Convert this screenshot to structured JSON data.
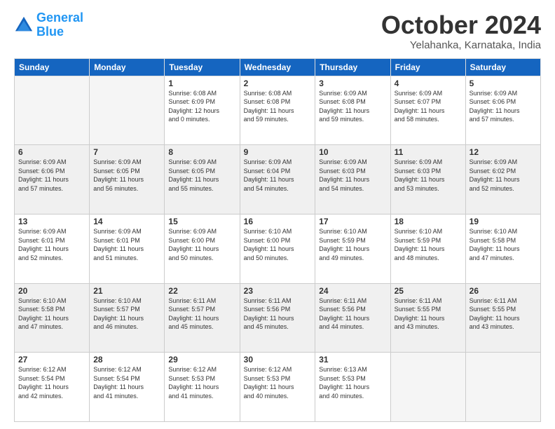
{
  "logo": {
    "text1": "General",
    "text2": "Blue"
  },
  "title": "October 2024",
  "subtitle": "Yelahanka, Karnataka, India",
  "weekdays": [
    "Sunday",
    "Monday",
    "Tuesday",
    "Wednesday",
    "Thursday",
    "Friday",
    "Saturday"
  ],
  "weeks": [
    [
      {
        "num": "",
        "info": ""
      },
      {
        "num": "",
        "info": ""
      },
      {
        "num": "1",
        "info": "Sunrise: 6:08 AM\nSunset: 6:09 PM\nDaylight: 12 hours\nand 0 minutes."
      },
      {
        "num": "2",
        "info": "Sunrise: 6:08 AM\nSunset: 6:08 PM\nDaylight: 11 hours\nand 59 minutes."
      },
      {
        "num": "3",
        "info": "Sunrise: 6:09 AM\nSunset: 6:08 PM\nDaylight: 11 hours\nand 59 minutes."
      },
      {
        "num": "4",
        "info": "Sunrise: 6:09 AM\nSunset: 6:07 PM\nDaylight: 11 hours\nand 58 minutes."
      },
      {
        "num": "5",
        "info": "Sunrise: 6:09 AM\nSunset: 6:06 PM\nDaylight: 11 hours\nand 57 minutes."
      }
    ],
    [
      {
        "num": "6",
        "info": "Sunrise: 6:09 AM\nSunset: 6:06 PM\nDaylight: 11 hours\nand 57 minutes."
      },
      {
        "num": "7",
        "info": "Sunrise: 6:09 AM\nSunset: 6:05 PM\nDaylight: 11 hours\nand 56 minutes."
      },
      {
        "num": "8",
        "info": "Sunrise: 6:09 AM\nSunset: 6:05 PM\nDaylight: 11 hours\nand 55 minutes."
      },
      {
        "num": "9",
        "info": "Sunrise: 6:09 AM\nSunset: 6:04 PM\nDaylight: 11 hours\nand 54 minutes."
      },
      {
        "num": "10",
        "info": "Sunrise: 6:09 AM\nSunset: 6:03 PM\nDaylight: 11 hours\nand 54 minutes."
      },
      {
        "num": "11",
        "info": "Sunrise: 6:09 AM\nSunset: 6:03 PM\nDaylight: 11 hours\nand 53 minutes."
      },
      {
        "num": "12",
        "info": "Sunrise: 6:09 AM\nSunset: 6:02 PM\nDaylight: 11 hours\nand 52 minutes."
      }
    ],
    [
      {
        "num": "13",
        "info": "Sunrise: 6:09 AM\nSunset: 6:01 PM\nDaylight: 11 hours\nand 52 minutes."
      },
      {
        "num": "14",
        "info": "Sunrise: 6:09 AM\nSunset: 6:01 PM\nDaylight: 11 hours\nand 51 minutes."
      },
      {
        "num": "15",
        "info": "Sunrise: 6:09 AM\nSunset: 6:00 PM\nDaylight: 11 hours\nand 50 minutes."
      },
      {
        "num": "16",
        "info": "Sunrise: 6:10 AM\nSunset: 6:00 PM\nDaylight: 11 hours\nand 50 minutes."
      },
      {
        "num": "17",
        "info": "Sunrise: 6:10 AM\nSunset: 5:59 PM\nDaylight: 11 hours\nand 49 minutes."
      },
      {
        "num": "18",
        "info": "Sunrise: 6:10 AM\nSunset: 5:59 PM\nDaylight: 11 hours\nand 48 minutes."
      },
      {
        "num": "19",
        "info": "Sunrise: 6:10 AM\nSunset: 5:58 PM\nDaylight: 11 hours\nand 47 minutes."
      }
    ],
    [
      {
        "num": "20",
        "info": "Sunrise: 6:10 AM\nSunset: 5:58 PM\nDaylight: 11 hours\nand 47 minutes."
      },
      {
        "num": "21",
        "info": "Sunrise: 6:10 AM\nSunset: 5:57 PM\nDaylight: 11 hours\nand 46 minutes."
      },
      {
        "num": "22",
        "info": "Sunrise: 6:11 AM\nSunset: 5:57 PM\nDaylight: 11 hours\nand 45 minutes."
      },
      {
        "num": "23",
        "info": "Sunrise: 6:11 AM\nSunset: 5:56 PM\nDaylight: 11 hours\nand 45 minutes."
      },
      {
        "num": "24",
        "info": "Sunrise: 6:11 AM\nSunset: 5:56 PM\nDaylight: 11 hours\nand 44 minutes."
      },
      {
        "num": "25",
        "info": "Sunrise: 6:11 AM\nSunset: 5:55 PM\nDaylight: 11 hours\nand 43 minutes."
      },
      {
        "num": "26",
        "info": "Sunrise: 6:11 AM\nSunset: 5:55 PM\nDaylight: 11 hours\nand 43 minutes."
      }
    ],
    [
      {
        "num": "27",
        "info": "Sunrise: 6:12 AM\nSunset: 5:54 PM\nDaylight: 11 hours\nand 42 minutes."
      },
      {
        "num": "28",
        "info": "Sunrise: 6:12 AM\nSunset: 5:54 PM\nDaylight: 11 hours\nand 41 minutes."
      },
      {
        "num": "29",
        "info": "Sunrise: 6:12 AM\nSunset: 5:53 PM\nDaylight: 11 hours\nand 41 minutes."
      },
      {
        "num": "30",
        "info": "Sunrise: 6:12 AM\nSunset: 5:53 PM\nDaylight: 11 hours\nand 40 minutes."
      },
      {
        "num": "31",
        "info": "Sunrise: 6:13 AM\nSunset: 5:53 PM\nDaylight: 11 hours\nand 40 minutes."
      },
      {
        "num": "",
        "info": ""
      },
      {
        "num": "",
        "info": ""
      }
    ]
  ]
}
